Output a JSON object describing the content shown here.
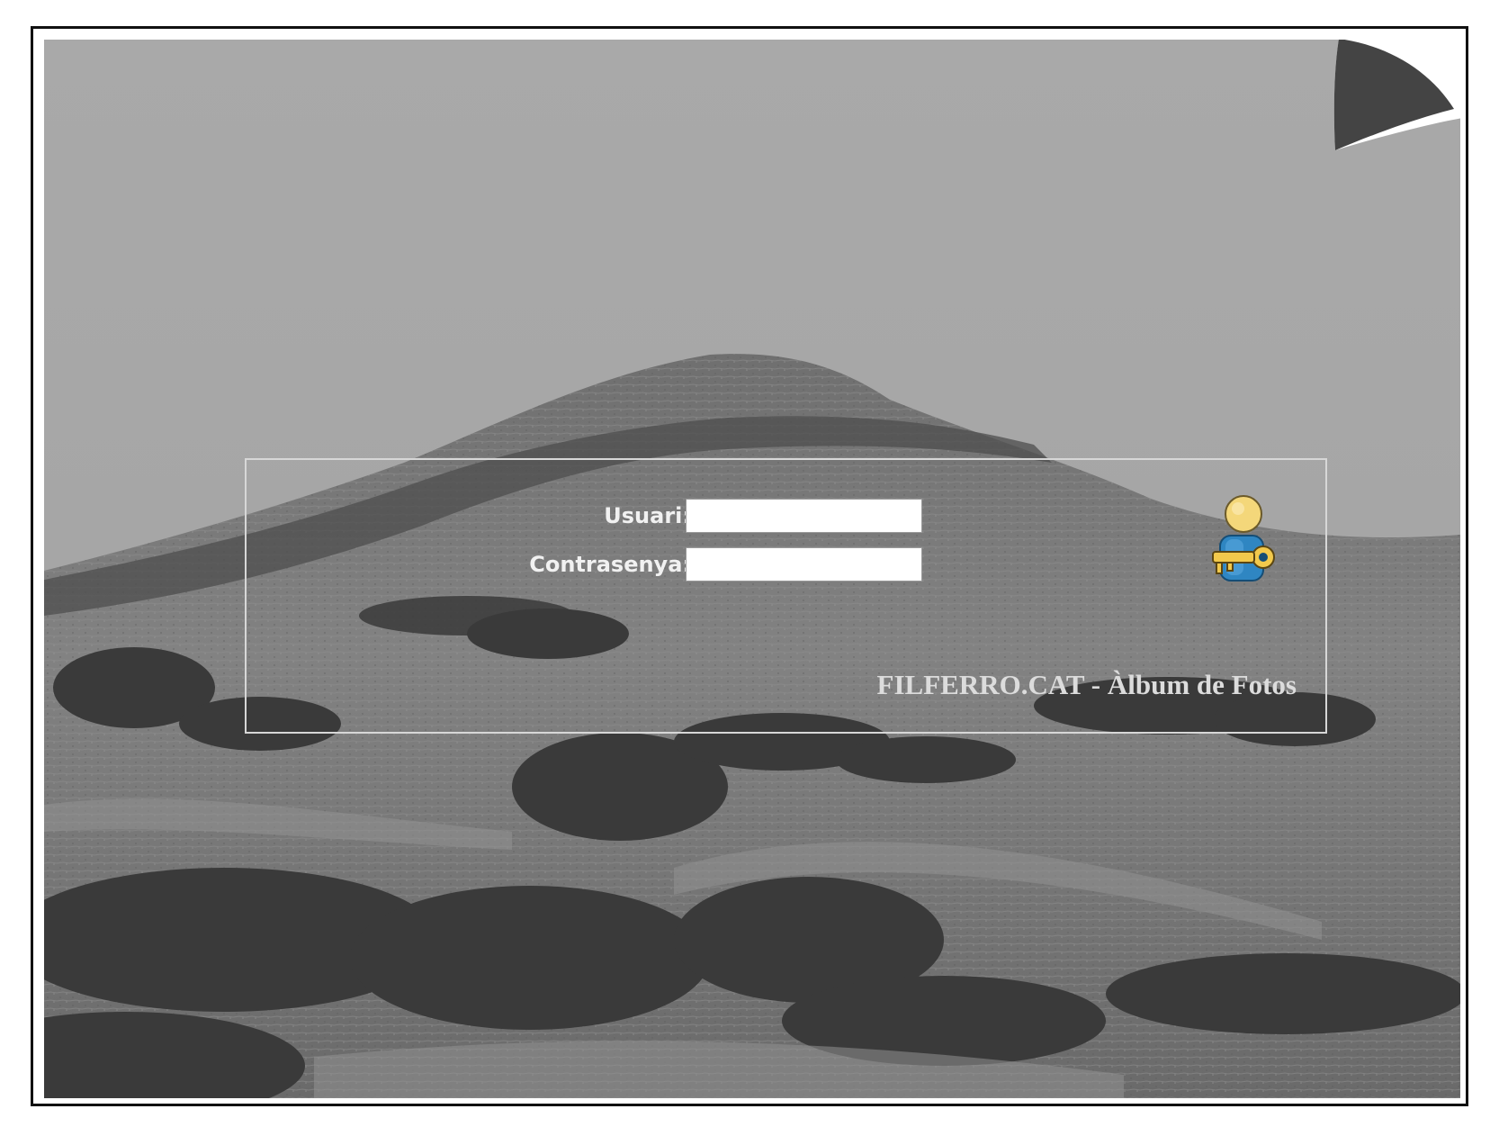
{
  "login": {
    "username_label": "Usuari:",
    "username_value": "",
    "password_label": "Contrasenya:",
    "password_value": ""
  },
  "footer": {
    "album_title": "FILFERRO.CAT - Àlbum de Fotos"
  },
  "icons": {
    "login_icon": "user-key-icon",
    "page_curl": "page-curl-icon"
  },
  "colors": {
    "sky": "#a7a7a7",
    "hill": "#7c7c7c",
    "trees": "#3a3a3a",
    "panel_border": "#d7d7d7",
    "label_text": "#f1f1f1",
    "title_text": "#dcdcdc"
  }
}
